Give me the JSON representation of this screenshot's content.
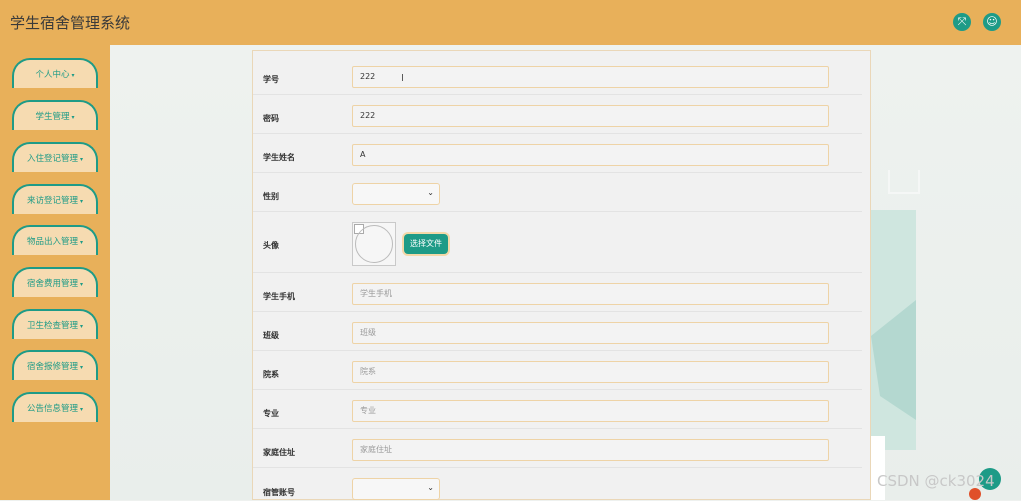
{
  "app": {
    "title": "学生宿舍管理系统"
  },
  "header": {
    "fullscreen_icon": "expand-arrows-icon",
    "user_icon": "user-icon"
  },
  "sidebar": {
    "items": [
      {
        "label": "个人中心"
      },
      {
        "label": "学生管理"
      },
      {
        "label": "入住登记管理"
      },
      {
        "label": "来访登记管理"
      },
      {
        "label": "物品出入管理"
      },
      {
        "label": "宿舍费用管理"
      },
      {
        "label": "卫生检查管理"
      },
      {
        "label": "宿舍报修管理"
      },
      {
        "label": "公告信息管理"
      }
    ],
    "caret": "▾"
  },
  "form": {
    "student_no": {
      "label": "学号",
      "value": "222"
    },
    "password": {
      "label": "密码",
      "value": "222"
    },
    "student_name": {
      "label": "学生姓名",
      "value": "A"
    },
    "gender": {
      "label": "性别",
      "value": ""
    },
    "avatar": {
      "label": "头像",
      "button": "选择文件"
    },
    "phone": {
      "label": "学生手机",
      "placeholder": "学生手机"
    },
    "class": {
      "label": "班级",
      "placeholder": "班级"
    },
    "department": {
      "label": "院系",
      "placeholder": "院系"
    },
    "major": {
      "label": "专业",
      "placeholder": "专业"
    },
    "address": {
      "label": "家庭住址",
      "placeholder": "家庭住址"
    },
    "dorm_manager": {
      "label": "宿管账号",
      "value": ""
    }
  },
  "watermark": "CSDN @ck3024",
  "colors": {
    "accent": "#1e9b87",
    "header_bg": "#e8b05a",
    "input_border": "#eed3a6"
  }
}
